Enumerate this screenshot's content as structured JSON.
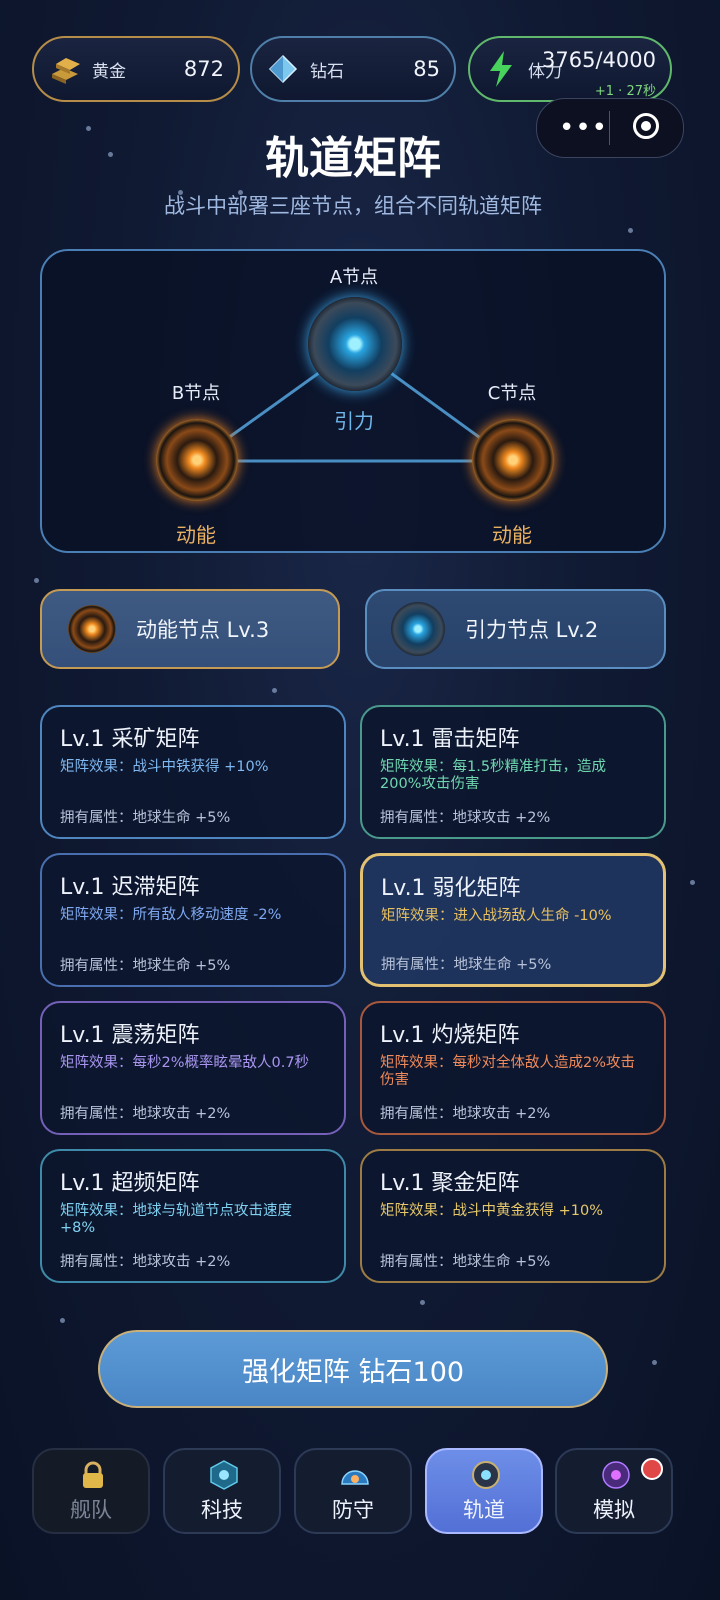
{
  "resources": {
    "gold": {
      "label": "黄金",
      "value": "872"
    },
    "diamond": {
      "label": "钻石",
      "value": "85"
    },
    "energy": {
      "label": "体力",
      "value": "3765/4000",
      "regen": "+1 · 27秒"
    }
  },
  "header": {
    "title": "轨道矩阵",
    "subtitle": "战斗中部署三座节点，组合不同轨道矩阵"
  },
  "matrix": {
    "node_a": {
      "label": "A节点",
      "type": "引力"
    },
    "node_b": {
      "label": "B节点",
      "type": "动能"
    },
    "node_c": {
      "label": "C节点",
      "type": "动能"
    }
  },
  "node_buttons": [
    {
      "label": "动能节点  Lv.3"
    },
    {
      "label": "引力节点  Lv.2"
    }
  ],
  "cards": [
    {
      "title": "Lv.1  采矿矩阵",
      "effect": "矩阵效果：战斗中铁获得 +10%",
      "attr": "拥有属性：地球生命 +5%",
      "effect_color": "#7fb8f0",
      "border": "#4f86c0"
    },
    {
      "title": "Lv.1  雷击矩阵",
      "effect": "矩阵效果：每1.5秒精准打击，造成200%攻击伤害",
      "attr": "拥有属性：地球攻击 +2%",
      "effect_color": "#6fd6b0",
      "border": "#4a9a8c"
    },
    {
      "title": "Lv.1  迟滞矩阵",
      "effect": "矩阵效果：所有敌人移动速度 -2%",
      "attr": "拥有属性：地球生命 +5%",
      "effect_color": "#7fa8f0",
      "border": "#4a6fb0"
    },
    {
      "title": "Lv.1  弱化矩阵",
      "effect": "矩阵效果：进入战场敌人生命 -10%",
      "attr": "拥有属性：地球生命 +5%",
      "effect_color": "#e8c060",
      "border": "#e2c272"
    },
    {
      "title": "Lv.1  震荡矩阵",
      "effect": "矩阵效果：每秒2%概率眩晕敌人0.7秒",
      "attr": "拥有属性：地球攻击 +2%",
      "effect_color": "#a995f0",
      "border": "#7560b8"
    },
    {
      "title": "Lv.1  灼烧矩阵",
      "effect": "矩阵效果：每秒对全体敌人造成2%攻击伤害",
      "attr": "拥有属性：地球攻击 +2%",
      "effect_color": "#f08a5a",
      "border": "#a8583c"
    },
    {
      "title": "Lv.1  超频矩阵",
      "effect": "矩阵效果：地球与轨道节点攻击速度 +8%",
      "attr": "拥有属性：地球攻击 +2%",
      "effect_color": "#7fd0f0",
      "border": "#3f8aa8"
    },
    {
      "title": "Lv.1  聚金矩阵",
      "effect": "矩阵效果：战斗中黄金获得 +10%",
      "attr": "拥有属性：地球生命 +5%",
      "effect_color": "#e6c86a",
      "border": "#9c7c44"
    }
  ],
  "upgrade_button": {
    "label": "强化矩阵  钻石100"
  },
  "tabs": [
    {
      "label": "舰队"
    },
    {
      "label": "科技"
    },
    {
      "label": "防守"
    },
    {
      "label": "轨道"
    },
    {
      "label": "模拟"
    }
  ],
  "colors": {
    "accent": "#5b8ec0",
    "gold_border": "#b58c48",
    "energy_border": "#5fb86b",
    "kinetic": "#f0a030",
    "gravity": "#60c8ff"
  }
}
